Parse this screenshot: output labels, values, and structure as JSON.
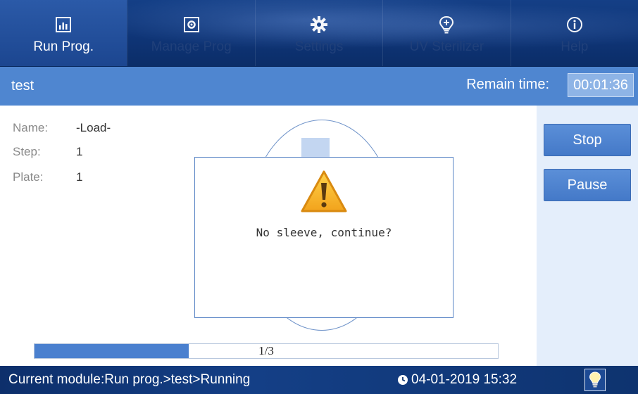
{
  "nav": {
    "items": [
      {
        "label": "Run Prog.",
        "icon": "chart-icon",
        "active": true
      },
      {
        "label": "Manage Prog",
        "icon": "settings-box-icon"
      },
      {
        "label": "Settings",
        "icon": "gear-icon"
      },
      {
        "label": "UV Sterilizer",
        "icon": "uv-bulb-icon"
      },
      {
        "label": "Help",
        "icon": "info-icon"
      }
    ]
  },
  "run": {
    "name": "test",
    "remain_label": "Remain time:",
    "remain_time": "00:01:36"
  },
  "info": {
    "name_label": "Name:",
    "name_value": "-Load-",
    "step_label": "Step:",
    "step_value": "1",
    "plate_label": "Plate:",
    "plate_value": "1"
  },
  "dialog": {
    "icon": "warning-icon",
    "message": "No sleeve, continue?"
  },
  "progress": {
    "text": "1/3",
    "fraction": 0.333
  },
  "side": {
    "stop_label": "Stop",
    "pause_label": "Pause"
  },
  "status": {
    "module": "Current module:Run prog.>test>Running",
    "datetime": "04-01-2019 15:32",
    "lamp_icon": "bulb-icon"
  },
  "colors": {
    "nav_bg": "#0f3577",
    "title_bar": "#4f86d0",
    "accent_button": "#4a80cf",
    "side_panel": "#e4eefb"
  }
}
